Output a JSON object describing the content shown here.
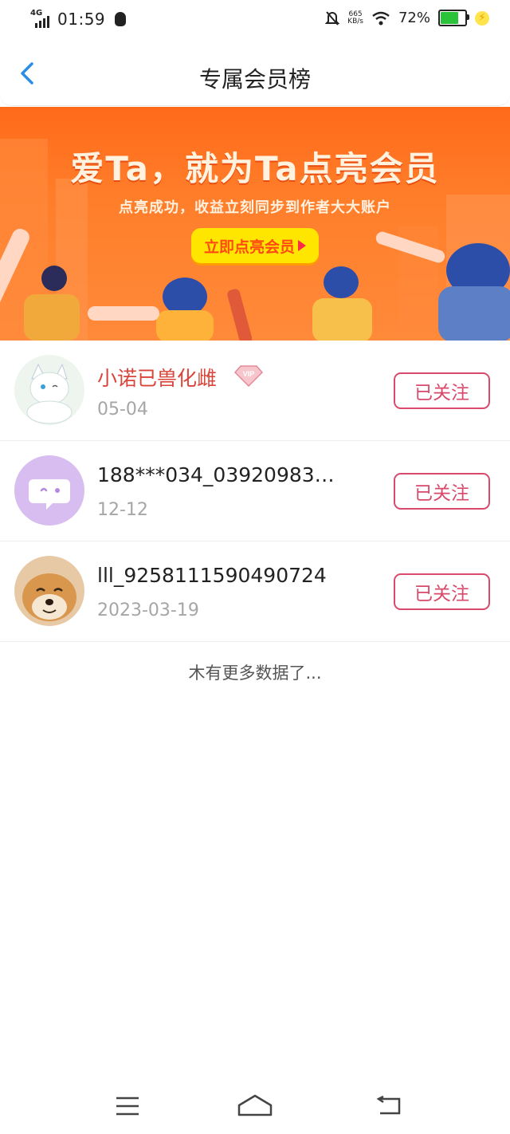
{
  "status_bar": {
    "network": "4G",
    "time": "01:59",
    "speed_value": "665",
    "speed_unit": "KB/s",
    "battery_percent": "72%",
    "battery_level": 0.72,
    "icons": [
      "signal-icon",
      "qq-icon",
      "mute-bell-icon",
      "wifi-icon",
      "battery-icon",
      "charging-icon"
    ]
  },
  "header": {
    "title": "专属会员榜",
    "back_icon": "chevron-left-icon",
    "accent_color": "#2a8de8"
  },
  "banner": {
    "title": "爱Ta，就为Ta点亮会员",
    "subtitle": "点亮成功，收益立刻同步到作者大大账户",
    "cta_label": "立即点亮会员",
    "cta_color": "#ffe600",
    "bg_color": "#ff6a1a"
  },
  "members": [
    {
      "name": "小诺已兽化雌",
      "is_vip": true,
      "vip_label": "VIP",
      "date": "05-04",
      "follow_label": "已关注",
      "avatar": "cat-avatar"
    },
    {
      "name": "188***034_03920983…",
      "is_vip": false,
      "date": "12-12",
      "follow_label": "已关注",
      "avatar": "chat-bubble-avatar"
    },
    {
      "name": "lll_9258111590490724",
      "is_vip": false,
      "date": "2023-03-19",
      "follow_label": "已关注",
      "avatar": "dog-avatar"
    }
  ],
  "footer_text": "木有更多数据了...",
  "colors": {
    "follow_border": "#d84a6b",
    "vip_name": "#d9453a"
  },
  "nav_icons": [
    "menu-icon",
    "home-icon",
    "back-icon"
  ]
}
